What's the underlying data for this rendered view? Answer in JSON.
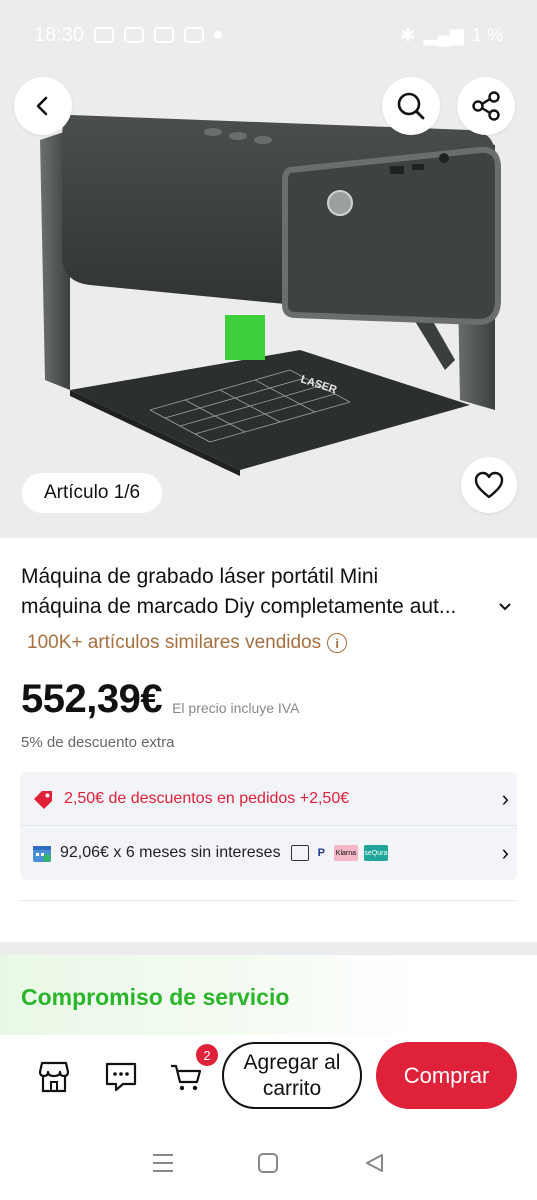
{
  "status_bar": {
    "time": "18:30",
    "battery": "1 %"
  },
  "header": {
    "back_icon": "chevron-left-icon",
    "search_icon": "search-icon",
    "share_icon": "share-icon"
  },
  "gallery": {
    "counter": "Artículo 1/6",
    "product_text": "LASER",
    "favorite_icon": "heart-icon"
  },
  "product": {
    "title_line1": "Máquina de grabado láser portátil Mini",
    "title_line2": "máquina de marcado Diy completamente aut...",
    "sold": "100K+ artículos similares vendidos",
    "price": "552,39€",
    "vat_note": "El precio incluye IVA",
    "extra_discount": "5% de descuento extra"
  },
  "promos": [
    {
      "text": "2,50€ de descuentos en pedidos +2,50€",
      "icon": "tag-icon",
      "color": "#e0213a"
    },
    {
      "text": "92,06€ x 6 meses sin intereses",
      "icon": "calendar-icon",
      "payment_methods": [
        "card",
        "P",
        "Klarna",
        "seQura"
      ]
    }
  ],
  "service": {
    "title": "Compromiso de servicio"
  },
  "bottom_bar": {
    "cart_badge": "2",
    "add_to_cart": "Agregar al carrito",
    "buy": "Comprar",
    "accent_color": "#e0213a"
  }
}
